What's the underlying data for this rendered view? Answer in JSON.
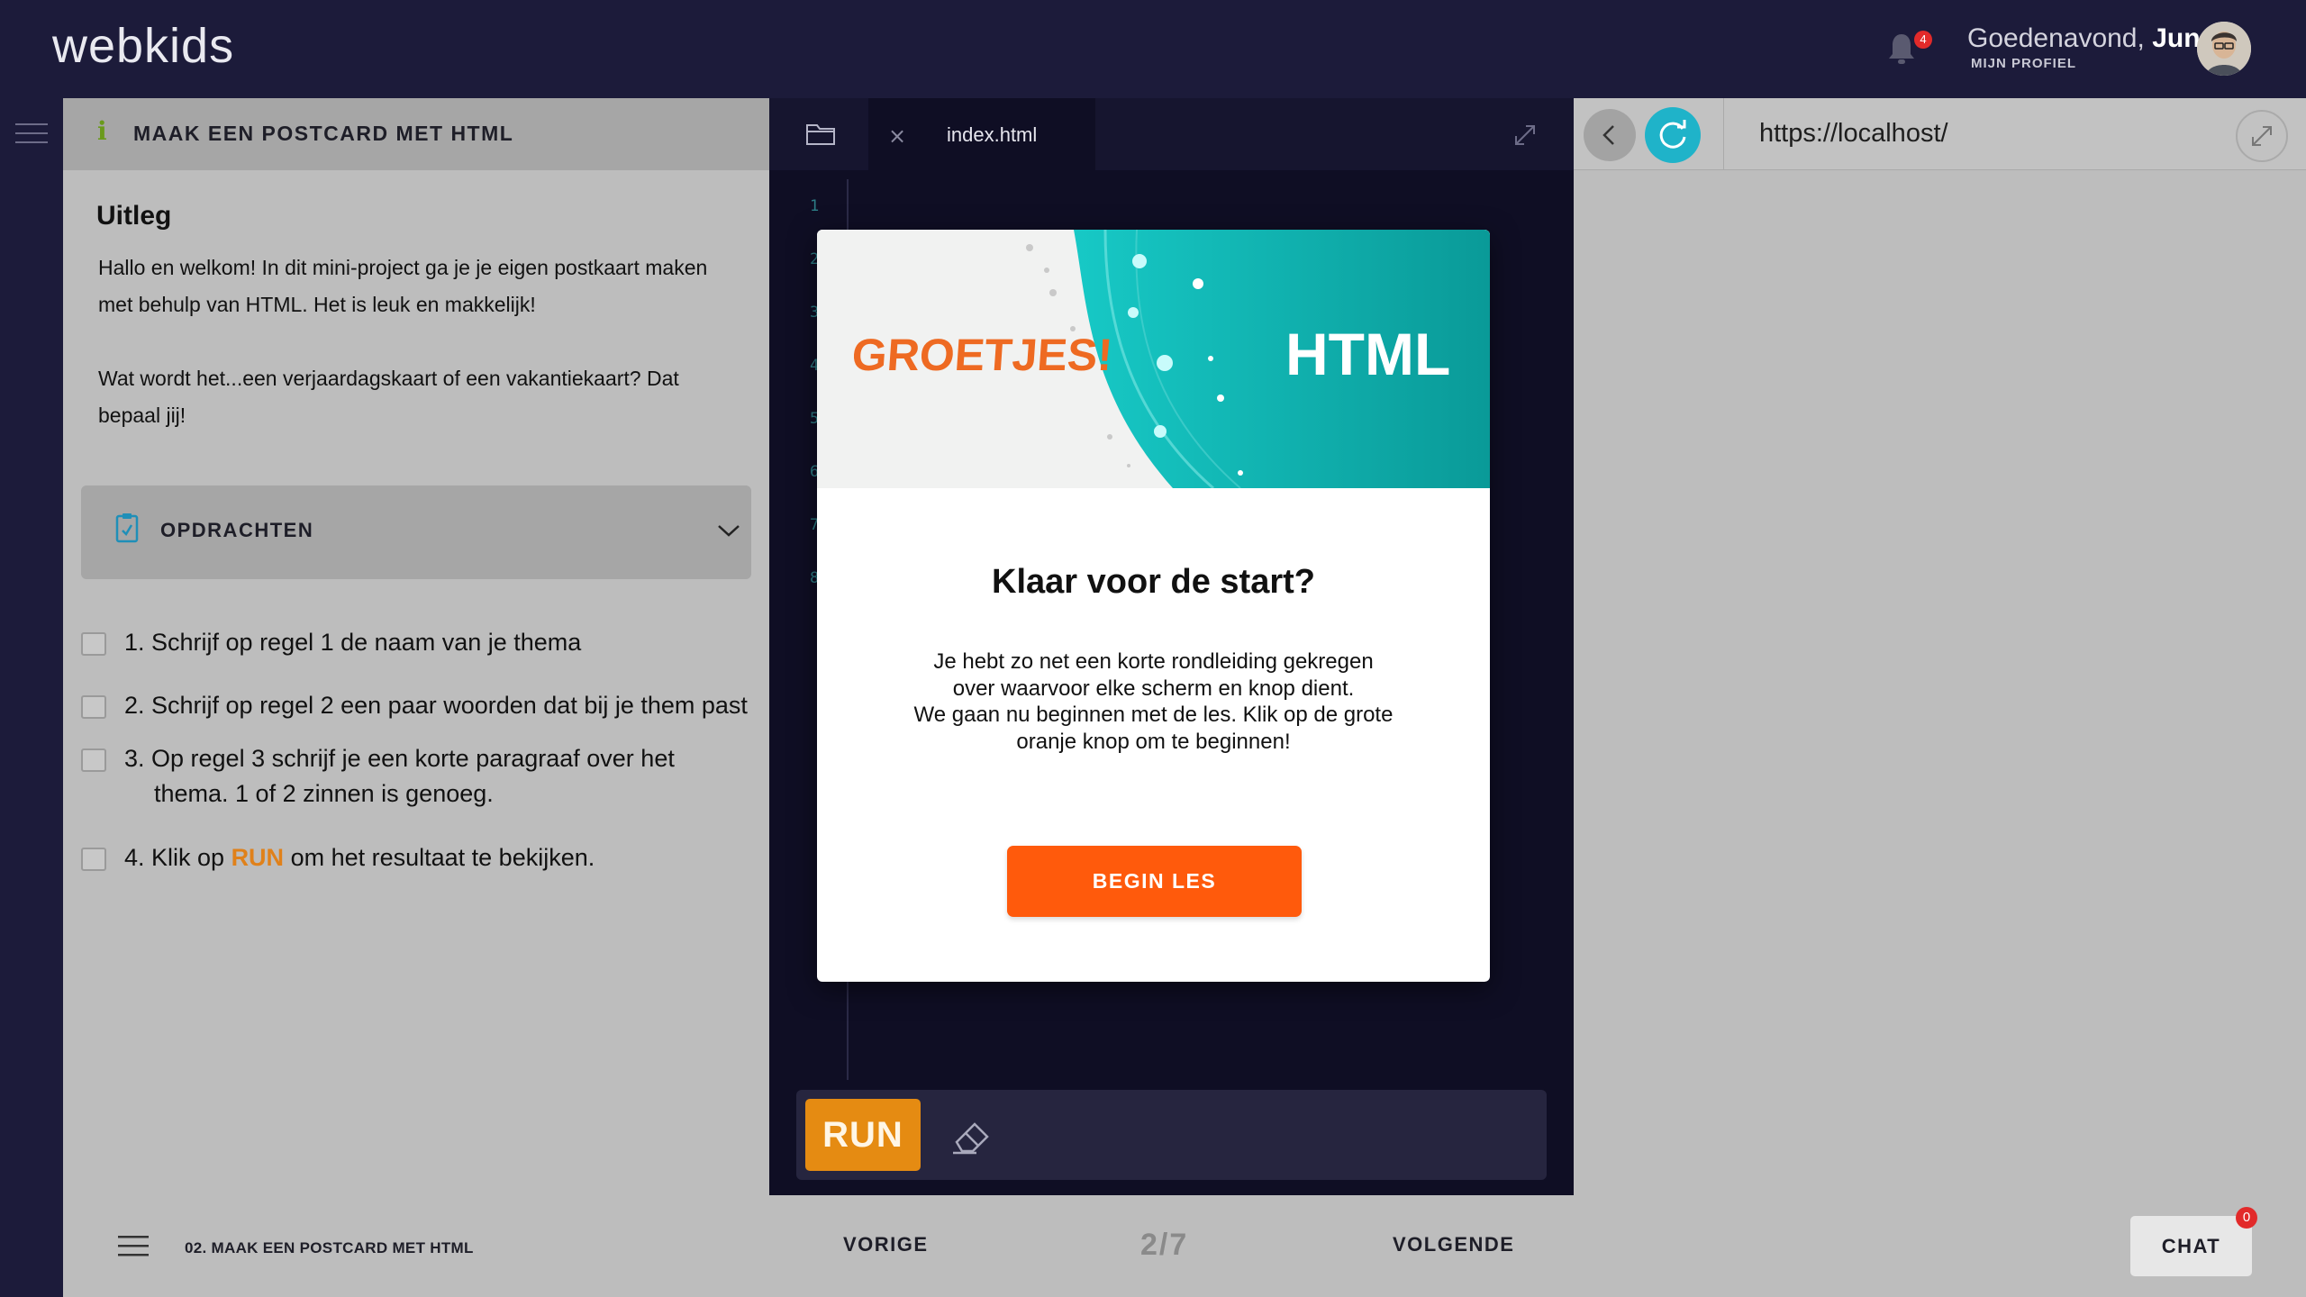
{
  "app": {
    "logo": "webkids",
    "notifications_count": "4",
    "greeting_prefix": "Goedenavond,",
    "user_name": "Jun",
    "profile_link": "MIJN PROFIEL"
  },
  "instructions": {
    "header_title": "MAAK EEN POSTCARD MET HTML",
    "section_title": "Uitleg",
    "intro_paragraphs": [
      "Hallo en welkom! In dit mini-project ga je je eigen postkaart maken met behulp van HTML. Het is leuk en makkelijk!",
      "Wat wordt het...een verjaardagskaart of een vakantiekaart? Dat bepaal jij!"
    ],
    "accordion_title": "OPDRACHTEN",
    "tasks": [
      {
        "text": "1. Schrijf op regel 1 de naam van je thema"
      },
      {
        "text": "2. Schrijf op regel 2 een paar woorden dat bij je them past"
      },
      {
        "line1": "3. Op regel 3 schrijf je een korte paragraaf over het",
        "line2": "thema. 1 of 2 zinnen is genoeg."
      },
      {
        "prefix": "4. Klik op ",
        "highlight": "RUN",
        "suffix": " om het resultaat te bekijken."
      }
    ]
  },
  "editor": {
    "tab_label": "index.html",
    "line_numbers": [
      "1",
      "2",
      "3",
      "4",
      "5",
      "6",
      "7",
      "8"
    ],
    "run_label": "RUN"
  },
  "preview": {
    "url": "https://localhost/"
  },
  "bottom_nav": {
    "course_label": "02. MAAK EEN POSTCARD MET HTML",
    "prev_label": "VORIGE",
    "pager": "2/7",
    "next_label": "VOLGENDE",
    "chat_label": "CHAT",
    "chat_count": "0"
  },
  "modal": {
    "banner_left": "GROETJES!",
    "banner_right": "HTML",
    "title": "Klaar voor de start?",
    "paragraph1": "Je hebt zo net een korte rondleiding gekregen over waarvoor elke scherm en knop dient.",
    "paragraph2": "We gaan nu beginnen met de les. Klik op de grote oranje knop om te beginnen!",
    "button_label": "BEGIN LES"
  },
  "colors": {
    "accent_orange": "#ff5a0c",
    "run_orange": "#e58b12",
    "teal": "#1fb3c9",
    "dark_bg": "#1c1b3a"
  }
}
